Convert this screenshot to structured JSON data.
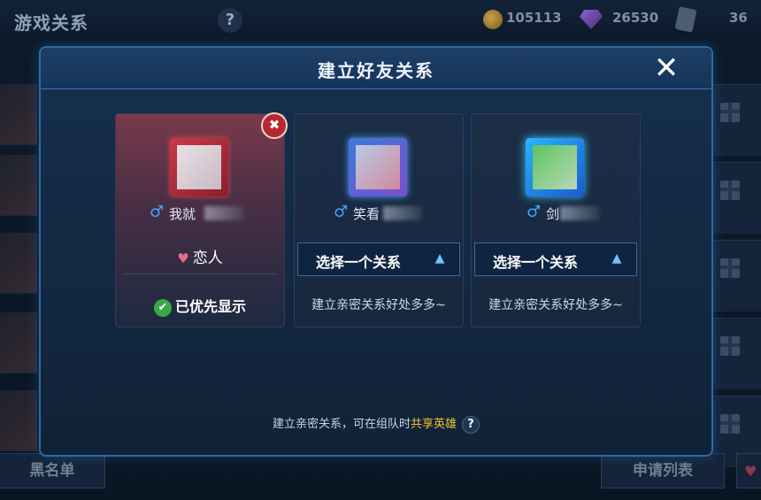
{
  "topbar": {
    "title": "游戏关系",
    "help": "?",
    "coins": "105113",
    "gems": "26530",
    "cards": "36"
  },
  "modal": {
    "title": "建立好友关系",
    "close": "✕",
    "cards": [
      {
        "gender_symbol": "♂",
        "name": "我就",
        "relation": "恋人",
        "status": "已优先显示",
        "remove": "✖"
      },
      {
        "gender_symbol": "♂",
        "name": "笑看",
        "select_label": "选择一个关系",
        "benefit": "建立亲密关系好处多多~"
      },
      {
        "gender_symbol": "♂",
        "name": "剑",
        "select_label": "选择一个关系",
        "benefit": "建立亲密关系好处多多~"
      }
    ],
    "footer": {
      "prefix": "建立亲密关系，可在组队时",
      "highlight": "共享英雄",
      "help": "?"
    }
  },
  "bottom": {
    "blacklist": "黑名单",
    "apply_list": "申请列表"
  }
}
